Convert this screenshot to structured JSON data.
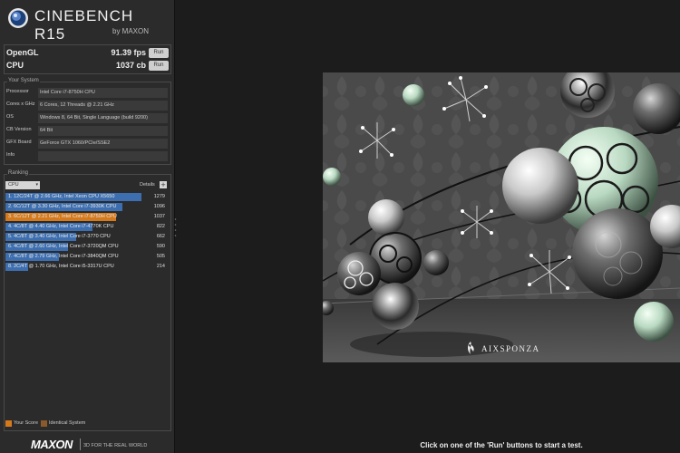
{
  "app": {
    "title": "CINEBENCH R15",
    "byline": "by MAXON"
  },
  "benchmarks": [
    {
      "label": "OpenGL",
      "value": "91.39 fps",
      "button": "Run"
    },
    {
      "label": "CPU",
      "value": "1037 cb",
      "button": "Run"
    }
  ],
  "system": {
    "title": "Your System",
    "rows": [
      {
        "key": "Processor",
        "value": "Intel Core i7-8750H CPU"
      },
      {
        "key": "Cores x GHz",
        "value": "6 Cores, 12 Threads @ 2.21 GHz"
      },
      {
        "key": "OS",
        "value": "Windows 8, 64 Bit, Single Language (build 9200)"
      },
      {
        "key": "CB Version",
        "value": "64 Bit"
      },
      {
        "key": "GFX Board",
        "value": "GeForce GTX 1060/PCIe/SSE2"
      },
      {
        "key": "Info",
        "value": ""
      }
    ]
  },
  "ranking": {
    "title": "Ranking",
    "dropdown": "CPU",
    "details_label": "Details",
    "details_button": "+",
    "rows": [
      {
        "label": "1. 12C/24T @ 2.66 GHz, Intel Xeon CPU X5650",
        "score": "1279",
        "value": 1279,
        "color": "#3d6fb0"
      },
      {
        "label": "2. 6C/12T @ 3.30 GHz,  Intel Core i7-3930K CPU",
        "score": "1096",
        "value": 1096,
        "color": "#3d6fb0"
      },
      {
        "label": "3. 6C/12T @ 2.21 GHz, Intel Core i7-8750H CPU",
        "score": "1037",
        "value": 1037,
        "color": "#d57a1c"
      },
      {
        "label": "4. 4C/8T @ 4.40 GHz, Intel Core i7-4770K CPU",
        "score": "822",
        "value": 822,
        "color": "#3d6fb0"
      },
      {
        "label": "5. 4C/8T @ 3.40 GHz,  Intel Core i7-3770 CPU",
        "score": "662",
        "value": 662,
        "color": "#3d6fb0"
      },
      {
        "label": "6. 4C/8T @ 2.60 GHz, Intel Core i7-3720QM CPU",
        "score": "590",
        "value": 590,
        "color": "#3d6fb0"
      },
      {
        "label": "7. 4C/8T @ 2.79 GHz,  Intel Core i7-3840QM CPU",
        "score": "505",
        "value": 505,
        "color": "#3d6fb0"
      },
      {
        "label": "8. 2C/4T @ 1.70 GHz,  Intel Core i5-3317U CPU",
        "score": "214",
        "value": 214,
        "color": "#3d6fb0"
      }
    ],
    "max_value": 1279
  },
  "legend": {
    "your_score": "Your Score",
    "identical": "Identical System",
    "your_color": "#d57a1c",
    "identical_color": "#8a5a2a"
  },
  "footer": {
    "brand": "MAXON",
    "tagline": "3D FOR THE REAL WORLD"
  },
  "scene": {
    "watermark": "AIXSPONZA"
  },
  "status": "Click on one of the 'Run' buttons to start a test."
}
